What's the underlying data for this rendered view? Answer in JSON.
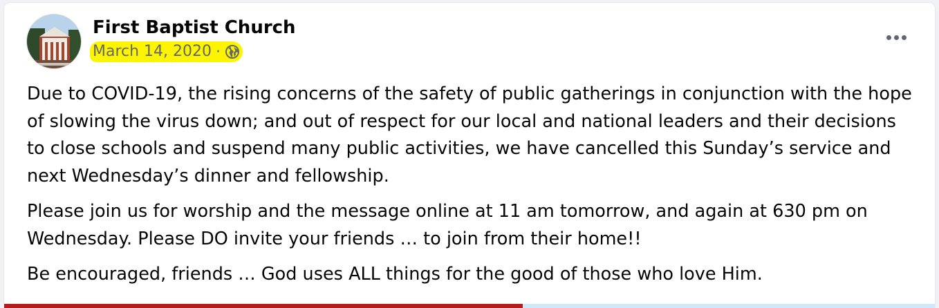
{
  "post": {
    "page_name": "First Baptist Church",
    "date": "March 14, 2020",
    "separator": "·",
    "audience_icon": "globe-icon",
    "more_icon": "more-options-icon",
    "paragraphs": [
      "Due to COVID-19, the rising concerns of the safety of public gatherings in conjunction with the hope of slowing the virus down; and out of respect for our local and national leaders and their decisions to close schools and suspend many public activities, we have cancelled this Sunday’s service and next Wednesday’s dinner and fellowship.",
      "Please join us for worship and the message online at 11 am tomorrow, and again at 630 pm on Wednesday. Please DO invite your friends … to join from their home!!",
      "Be encouraged, friends … God uses ALL things for the good of those who love Him."
    ]
  },
  "colors": {
    "highlight": "#fdf500",
    "secondary_text": "#65676b",
    "primary_text": "#050505",
    "bottom_bar_left": "#b71c1c",
    "bottom_bar_right": "#cfe8fb"
  }
}
